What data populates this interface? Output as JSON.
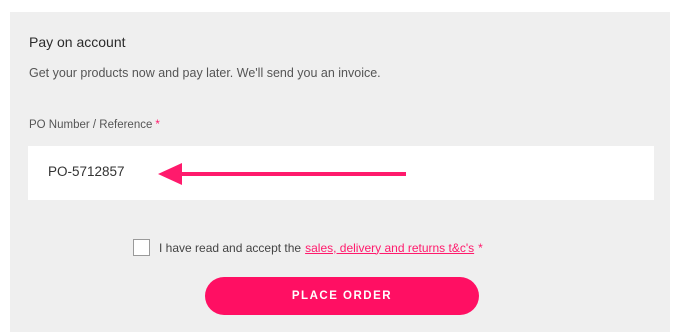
{
  "section": {
    "title": "Pay on account",
    "description": "Get your products now and pay later. We'll send you an invoice."
  },
  "po_field": {
    "label": "PO Number / Reference",
    "required_marker": "*",
    "value": "PO-5712857"
  },
  "terms": {
    "prefix": "I have read and accept the",
    "link_text": "sales, delivery and returns t&c's",
    "required_marker": "*",
    "checked": false
  },
  "actions": {
    "place_order_label": "PLACE ORDER"
  },
  "colors": {
    "accent": "#ff0f63",
    "panel_bg": "#efefef",
    "annotation_arrow": "#ff1a6c"
  },
  "icons": {
    "arrow": "arrow-left-icon"
  }
}
